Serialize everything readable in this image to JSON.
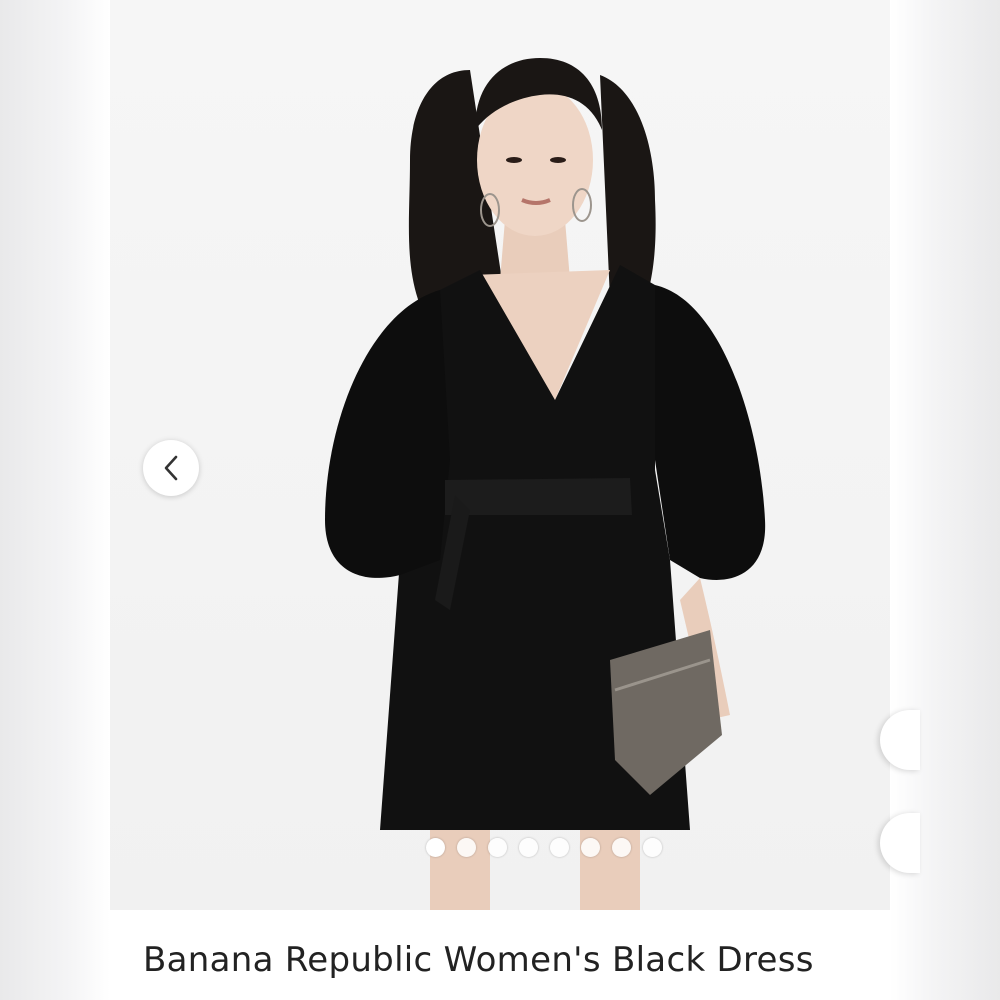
{
  "listing": {
    "title": "Banana Republic Women's Black Dress"
  },
  "gallery": {
    "image_count": 8,
    "active_index": 0,
    "prev_icon": "chevron-left-icon"
  },
  "colors": {
    "dress": "#111111",
    "background": "#f4f4f4",
    "text": "#222222"
  }
}
